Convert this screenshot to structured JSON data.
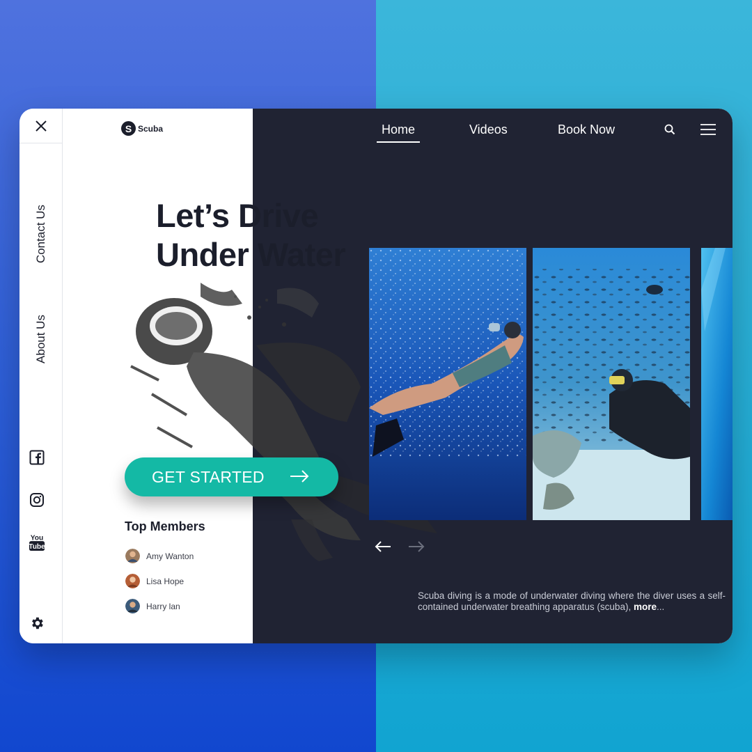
{
  "brand": {
    "logo_letter": "S",
    "name": "Scuba"
  },
  "nav": {
    "items": [
      {
        "label": "Home",
        "active": true
      },
      {
        "label": "Videos",
        "active": false
      },
      {
        "label": "Book Now",
        "active": false
      }
    ],
    "icons": [
      "search-icon",
      "menu-icon"
    ]
  },
  "rail": {
    "close_icon": "close-icon",
    "links": [
      {
        "label": "Contact Us"
      },
      {
        "label": "About Us"
      }
    ],
    "social": [
      "facebook-icon",
      "instagram-icon",
      "youtube-icon"
    ],
    "youtube_text": {
      "top": "You",
      "bottom": "Tube"
    },
    "settings_icon": "gear-icon"
  },
  "hero": {
    "title_line1": "Let’s Drive",
    "title_line2": "Under Water",
    "cta_label": "GET STARTED"
  },
  "members": {
    "title": "Top Members",
    "list": [
      {
        "name": "Amy Wanton"
      },
      {
        "name": "Lisa  Hope"
      },
      {
        "name": "Harry lan"
      }
    ]
  },
  "gallery": {
    "photos": [
      "freediver-photo",
      "scuba-diver-reef-photo",
      "blue-water-photo"
    ]
  },
  "description": {
    "text": "Scuba diving is a mode of underwater diving where the diver uses a self-contained underwater breathing apparatus (scuba), ",
    "more": "more",
    "ellipsis": "..."
  },
  "colors": {
    "accent": "#14b9a5",
    "dark": "#202333",
    "text": "#1b1e2b"
  }
}
